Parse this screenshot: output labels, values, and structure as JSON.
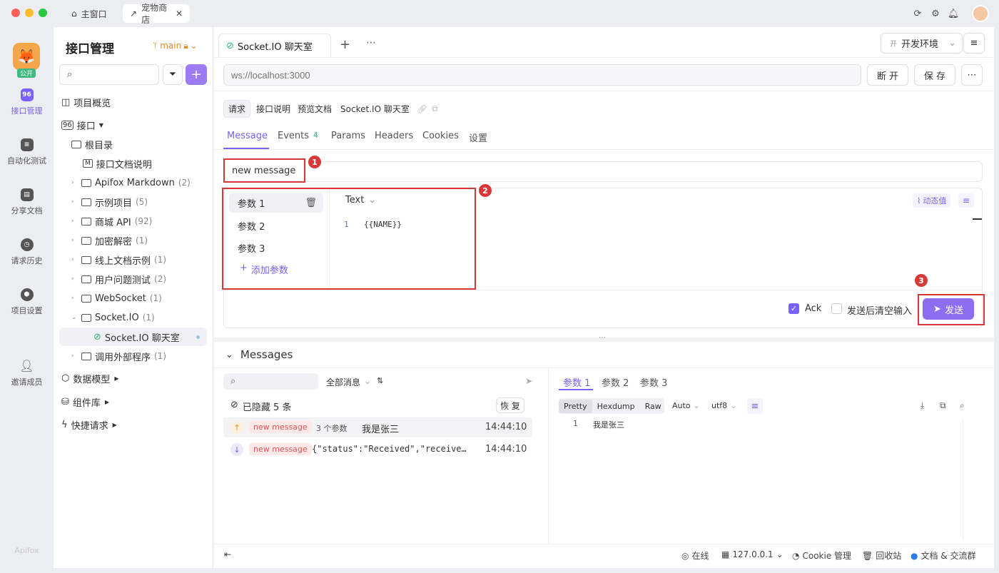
{
  "window": {
    "tabs": [
      {
        "label": "主窗口"
      },
      {
        "label": "宠物商店"
      }
    ]
  },
  "rail": {
    "project_badge": "公开",
    "items": [
      {
        "label": "接口管理"
      },
      {
        "label": "自动化测试"
      },
      {
        "label": "分享文档"
      },
      {
        "label": "请求历史"
      },
      {
        "label": "项目设置"
      },
      {
        "label": "邀请成员"
      }
    ],
    "brand": "Apifox"
  },
  "panel": {
    "title": "接口管理",
    "branch": "main",
    "overview": "项目概览",
    "api": "接口",
    "root": "根目录",
    "doc": "接口文档说明",
    "folders": [
      {
        "name": "Apifox Markdown",
        "count": "(2)"
      },
      {
        "name": "示例项目",
        "count": "(5)"
      },
      {
        "name": "商城 API",
        "count": "(92)"
      },
      {
        "name": "加密解密",
        "count": "(1)"
      },
      {
        "name": "线上文档示例",
        "count": "(1)"
      },
      {
        "name": "用户问题测试",
        "count": "(2)"
      },
      {
        "name": "WebSocket",
        "count": "(1)"
      },
      {
        "name": "Socket.IO",
        "count": "(1)"
      }
    ],
    "selected": "Socket.IO 聊天室",
    "last_folder": {
      "name": "调用外部程序",
      "count": "(1)"
    },
    "model": "数据模型",
    "components": "组件库",
    "quick": "快捷请求"
  },
  "header": {
    "tab_title": "Socket.IO 聊天室",
    "env": "开发环境",
    "env_icon": "开",
    "url_placeholder": "ws://localhost:3000",
    "disconnect": "断 开",
    "save": "保 存"
  },
  "request": {
    "chips": [
      "请求",
      "接口说明",
      "预览文档"
    ],
    "name": "Socket.IO 聊天室",
    "tabs": [
      {
        "label": "Message"
      },
      {
        "label": "Events"
      },
      {
        "label": "Params"
      },
      {
        "label": "Headers"
      },
      {
        "label": "Cookies"
      },
      {
        "label": "设置"
      }
    ],
    "events_count": "4",
    "event_name": "new message",
    "params": [
      "参数 1",
      "参数 2",
      "参数 3"
    ],
    "add_param": "添加参数",
    "format": "Text",
    "dynamic": "动态值",
    "code_line": "1",
    "code": "{{NAME}}",
    "ack": "Ack",
    "clear_after": "发送后清空输入",
    "send": "发送",
    "markers": [
      "1",
      "2",
      "3"
    ]
  },
  "messages": {
    "title": "Messages",
    "filter": "全部消息",
    "hidden": "已隐藏 5 条",
    "restore": "恢 复",
    "rows": [
      {
        "tag": "new message",
        "meta": "3 个参数",
        "text": "我是张三",
        "time": "14:44:10"
      },
      {
        "tag": "new message",
        "text": "{\"status\":\"Received\",\"receive…",
        "time": "14:44:10"
      }
    ],
    "detail_tabs": [
      "参数 1",
      "参数 2",
      "参数 3"
    ],
    "view": [
      "Pretty",
      "Hexdump",
      "Raw"
    ],
    "auto": "Auto",
    "enc": "utf8",
    "line": "1",
    "value": "我是张三"
  },
  "status": {
    "online": "在线",
    "ip": "127.0.0.1",
    "cookie": "Cookie 管理",
    "trash": "回收站",
    "docs": "文档 & 交流群"
  }
}
